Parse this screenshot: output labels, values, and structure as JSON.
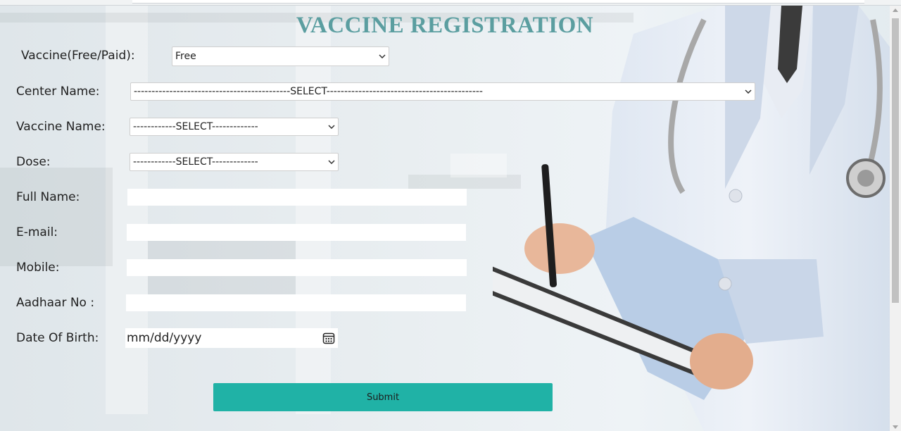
{
  "page": {
    "title": "VACCINE REGISTRATION",
    "accent_color": "#5b9ea0",
    "submit_color": "#20b2a6"
  },
  "form": {
    "vaccine_type": {
      "label": "Vaccine(Free/Paid):",
      "value": "Free"
    },
    "center_name": {
      "label": "Center Name:",
      "value": "--------------------------------------------SELECT--------------------------------------------"
    },
    "vaccine_name": {
      "label": "Vaccine Name:",
      "value": "------------SELECT-------------"
    },
    "dose": {
      "label": "Dose:",
      "value": "------------SELECT-------------"
    },
    "full_name": {
      "label": "Full Name:",
      "value": ""
    },
    "email": {
      "label": "E-mail:",
      "value": ""
    },
    "mobile": {
      "label": "Mobile:",
      "value": ""
    },
    "aadhaar": {
      "label": "Aadhaar No :",
      "value": ""
    },
    "dob": {
      "label": "Date Of Birth:",
      "placeholder": "mm/dd/yyyy",
      "icon": "calendar-icon"
    },
    "submit_label": "Submit"
  },
  "icons": {
    "select_chevron": "chevron-down-icon",
    "calendar": "calendar-icon"
  }
}
